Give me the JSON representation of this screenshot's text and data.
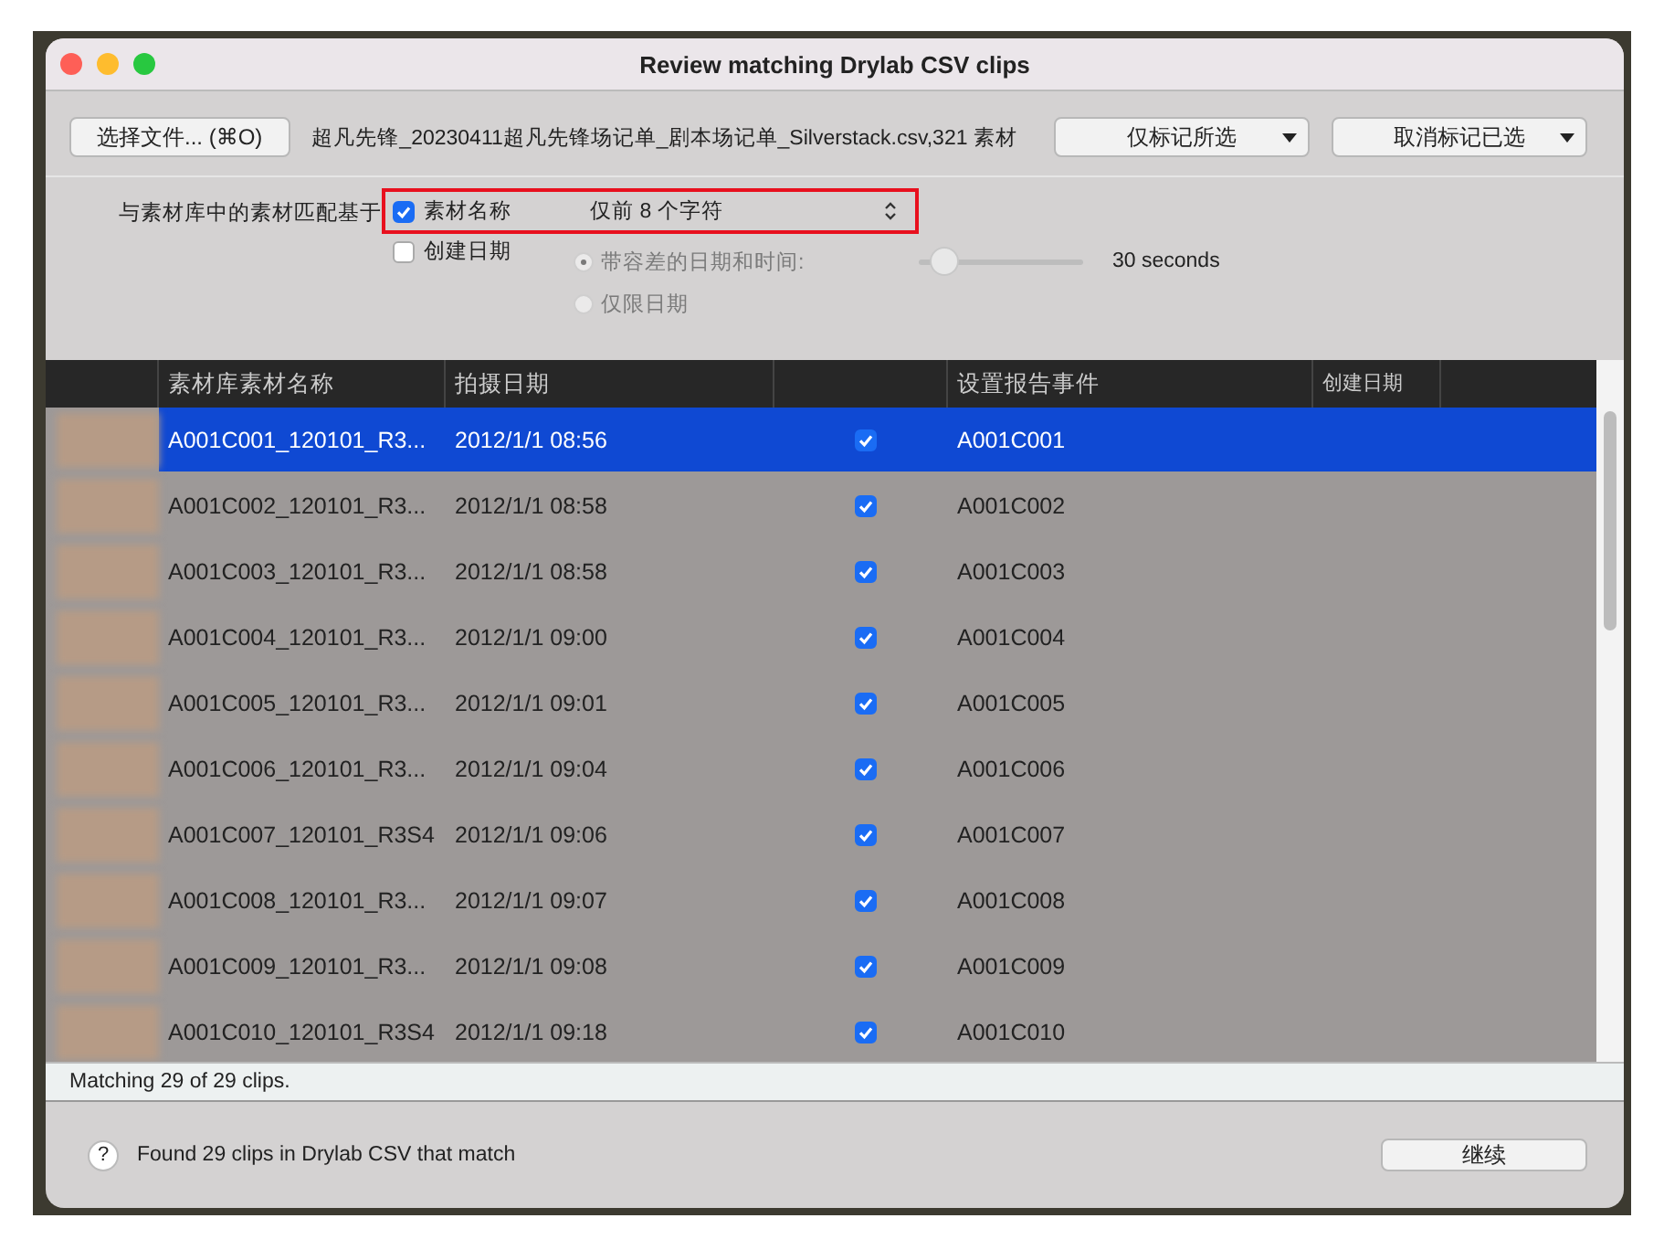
{
  "window": {
    "title": "Review matching Drylab CSV clips"
  },
  "toolbar": {
    "choose_button": "选择文件... (⌘O)",
    "file_info": "超凡先锋_20230411超凡先锋场记单_剧本场记单_Silverstack.csv,321 素材",
    "menus": [
      {
        "label": "仅标记所选"
      },
      {
        "label": "取消标记已选"
      }
    ]
  },
  "matching": {
    "label": "与素材库中的素材匹配基于",
    "options": [
      {
        "label": "素材名称",
        "checked": true,
        "popup": "仅前 8 个字符",
        "highlighted": true
      },
      {
        "label": "创建日期",
        "checked": false,
        "highlighted": false
      }
    ],
    "radios": [
      {
        "label": "带容差的日期和时间:",
        "selected": true,
        "disabled": true
      },
      {
        "label": "仅限日期",
        "selected": false,
        "disabled": true
      }
    ],
    "tolerance": {
      "level": 0.15,
      "reading": "30 seconds",
      "disabled": true
    }
  },
  "table": {
    "columns": [
      {
        "label": "素材库素材名称"
      },
      {
        "label": "拍摄日期"
      },
      {
        "label": "设置报告事件"
      },
      {
        "label": "创建日期"
      }
    ],
    "rows": [
      {
        "name": "A001C001_120101_R3...",
        "date": "2012/1/1 08:56",
        "checked": true,
        "event": "A001C001",
        "selected": true
      },
      {
        "name": "A001C002_120101_R3...",
        "date": "2012/1/1 08:58",
        "checked": true,
        "event": "A001C002",
        "selected": false
      },
      {
        "name": "A001C003_120101_R3...",
        "date": "2012/1/1 08:58",
        "checked": true,
        "event": "A001C003",
        "selected": false
      },
      {
        "name": "A001C004_120101_R3...",
        "date": "2012/1/1 09:00",
        "checked": true,
        "event": "A001C004",
        "selected": false
      },
      {
        "name": "A001C005_120101_R3...",
        "date": "2012/1/1 09:01",
        "checked": true,
        "event": "A001C005",
        "selected": false
      },
      {
        "name": "A001C006_120101_R3...",
        "date": "2012/1/1 09:04",
        "checked": true,
        "event": "A001C006",
        "selected": false
      },
      {
        "name": "A001C007_120101_R3S4",
        "date": "2012/1/1 09:06",
        "checked": true,
        "event": "A001C007",
        "selected": false
      },
      {
        "name": "A001C008_120101_R3...",
        "date": "2012/1/1 09:07",
        "checked": true,
        "event": "A001C008",
        "selected": false
      },
      {
        "name": "A001C009_120101_R3...",
        "date": "2012/1/1 09:08",
        "checked": true,
        "event": "A001C009",
        "selected": false
      },
      {
        "name": "A001C010_120101_R3S4",
        "date": "2012/1/1 09:18",
        "checked": true,
        "event": "A001C010",
        "selected": false
      }
    ]
  },
  "status_bar": {
    "text": "Matching 29 of 29 clips."
  },
  "footer": {
    "help": "?",
    "message": "Found 29 clips in Drylab CSV that match",
    "continue_button": "继续"
  }
}
